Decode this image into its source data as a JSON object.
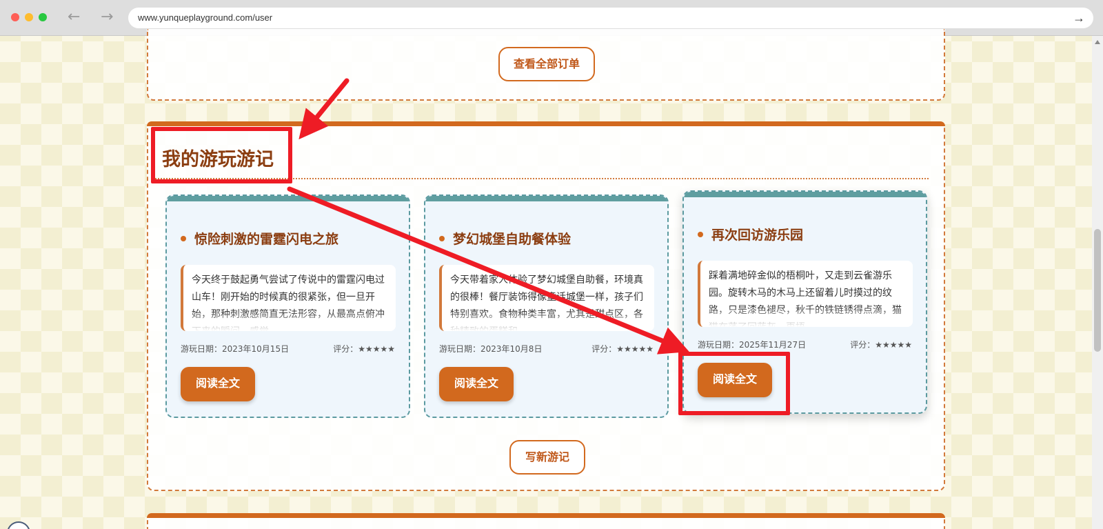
{
  "browser": {
    "url": "www.yunqueplayground.com/user",
    "back_icon": "←",
    "forward_icon": "→",
    "go_icon": "→"
  },
  "orders": {
    "view_all_label": "查看全部订单"
  },
  "journal": {
    "title": "我的游玩游记",
    "write_label": "写新游记",
    "cards": [
      {
        "title": "惊险刺激的雷霆闪电之旅",
        "excerpt": "今天终于鼓起勇气尝试了传说中的雷霆闪电过山车！刚开始的时候真的很紧张，但一旦开始，那种刺激感简直无法形容，从最高点俯冲下来的瞬间，感觉",
        "date": "游玩日期：2023年10月15日",
        "rating": "评分：★★★★★",
        "read_label": "阅读全文"
      },
      {
        "title": "梦幻城堡自助餐体验",
        "excerpt": "今天带着家人体验了梦幻城堡自助餐，环境真的很棒！餐厅装饰得像童话城堡一样，孩子们特别喜欢。食物种类丰富，尤其是甜点区，各种精致的蛋糕和",
        "date": "游玩日期：2023年10月8日",
        "rating": "评分：★★★★★",
        "read_label": "阅读全文"
      },
      {
        "title": "再次回访游乐园",
        "excerpt": "踩着满地碎金似的梧桐叶，又走到云雀游乐园。旋转木马的木马上还留着儿时摸过的纹路，只是漆色褪尽，秋千的铁链锈得点滴，猫猫在荡了回蓝灰，再捂",
        "date": "游玩日期：2025年11月27日",
        "rating": "评分：★★★★★",
        "read_label": "阅读全文"
      }
    ]
  },
  "colors": {
    "accent": "#d2691e",
    "annotation": "#ee1c25",
    "card_strip": "#5f9ea0",
    "title_text": "#8b3d10"
  }
}
